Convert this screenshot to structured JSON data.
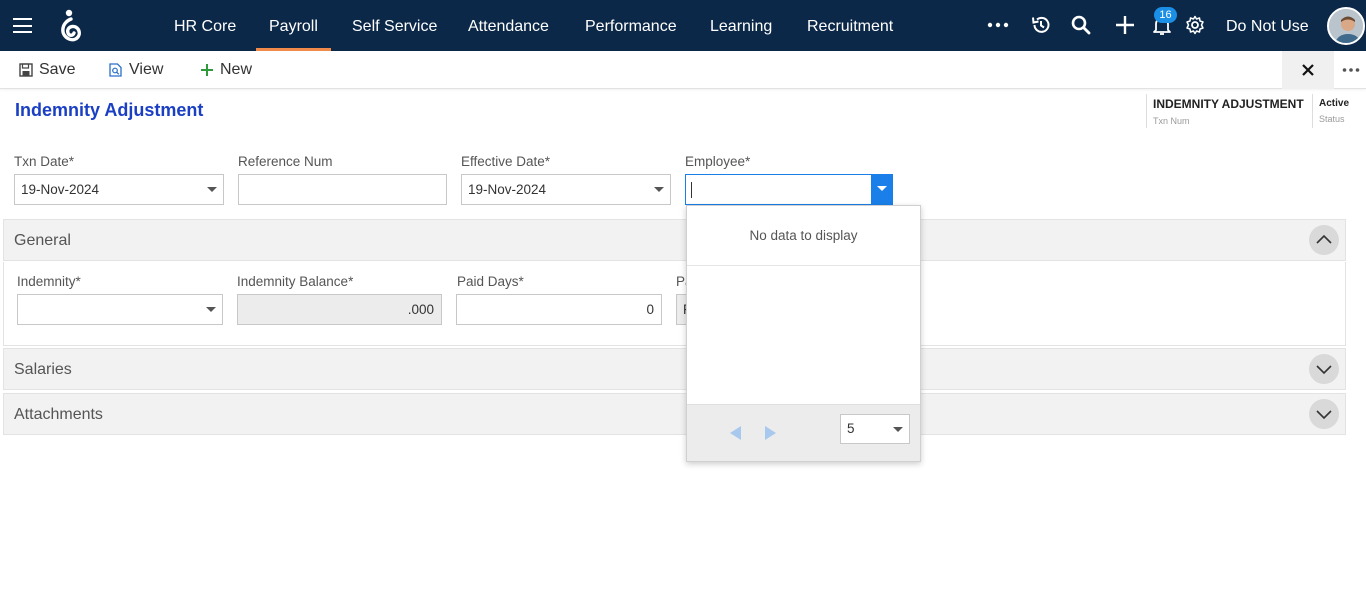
{
  "nav": {
    "items": [
      {
        "label": "HR Core",
        "active": false
      },
      {
        "label": "Payroll",
        "active": true
      },
      {
        "label": "Self Service",
        "active": false
      },
      {
        "label": "Attendance",
        "active": false
      },
      {
        "label": "Performance",
        "active": false
      },
      {
        "label": "Learning",
        "active": false
      },
      {
        "label": "Recruitment",
        "active": false
      }
    ],
    "notification_count": "16",
    "user_name": "Do Not Use",
    "icons": [
      "menu-icon",
      "more-icon",
      "history-icon",
      "search-icon",
      "add-icon",
      "bell-icon",
      "gear-icon"
    ],
    "colors": {
      "bar": "#0c2848",
      "active_underline": "#f08a4b",
      "badge": "#1b8ee6"
    }
  },
  "toolbar": {
    "save_label": "Save",
    "view_label": "View",
    "new_label": "New"
  },
  "page": {
    "title": "Indemnity Adjustment",
    "txn_num_value": "INDEMNITY ADJUSTMENT",
    "txn_num_label": "Txn Num",
    "status_value": "Active",
    "status_label": "Status",
    "title_color": "#1a3fc4"
  },
  "header_fields": {
    "txn_date": {
      "label": "Txn Date",
      "required_mark": "*",
      "value": "19-Nov-2024"
    },
    "reference_num": {
      "label": "Reference Num",
      "value": ""
    },
    "effective_date": {
      "label": "Effective Date",
      "required_mark": "*",
      "value": "19-Nov-2024"
    },
    "employee": {
      "label": "Employee",
      "required_mark": "*",
      "value": ""
    }
  },
  "sections": {
    "general": {
      "title": "General",
      "expanded": true,
      "fields": {
        "indemnity": {
          "label": "Indemnity",
          "required_mark": "*",
          "value": ""
        },
        "indemnity_balance": {
          "label": "Indemnity Balance",
          "required_mark": "*",
          "value": ".000"
        },
        "paid_days": {
          "label": "Paid Days",
          "required_mark": "*",
          "value": "0"
        },
        "paid_amount_label_fragment": "Pa",
        "paid_amount_value_fragment": "F"
      }
    },
    "salaries": {
      "title": "Salaries",
      "expanded": false
    },
    "attachments": {
      "title": "Attachments",
      "expanded": false
    }
  },
  "employee_dropdown": {
    "empty_text": "No data to display",
    "page_size": "5"
  }
}
